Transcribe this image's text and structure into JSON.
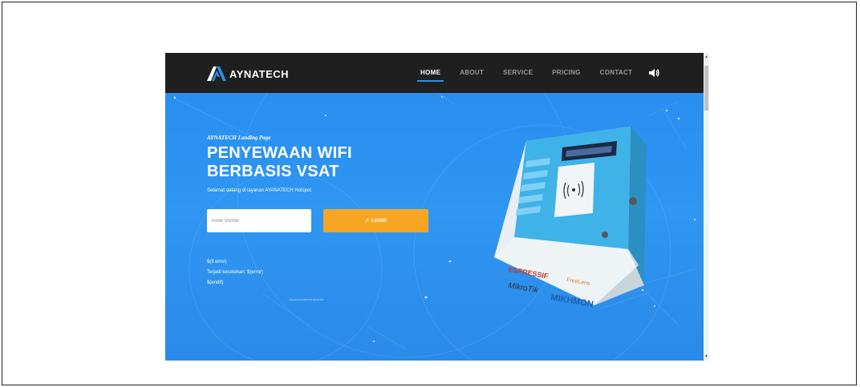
{
  "brand": {
    "name": "AYNATECH"
  },
  "nav": [
    {
      "label": "HOME",
      "active": true
    },
    {
      "label": "ABOUT"
    },
    {
      "label": "SERVICE"
    },
    {
      "label": "PRICING"
    },
    {
      "label": "CONTACT"
    }
  ],
  "hero": {
    "eyebrow": "AYNATECH Landing Page",
    "headline_line1": "PENYEWAAN WIFI",
    "headline_line2": "BERBASIS VSAT",
    "welcome": "Selamat datang di layanan AYANATECH Hotspot",
    "voucher_placeholder": "Kode Vocher",
    "login_label": "LOGIN",
    "template_lines": [
      "$(if error)",
      "Terjadi kesalahan: $(error)",
      "$(endif)"
    ],
    "powered": "Powered by MikroTik RouterOS"
  },
  "kiosk": {
    "brand_labels": [
      "ESPRESSIF",
      "FreeLens",
      "MikroTik",
      "MIKHMON"
    ]
  },
  "colors": {
    "navbar": "#1f1f1f",
    "hero": "#2f96f2",
    "accent": "#2b8fef",
    "login": "#f6a623"
  }
}
